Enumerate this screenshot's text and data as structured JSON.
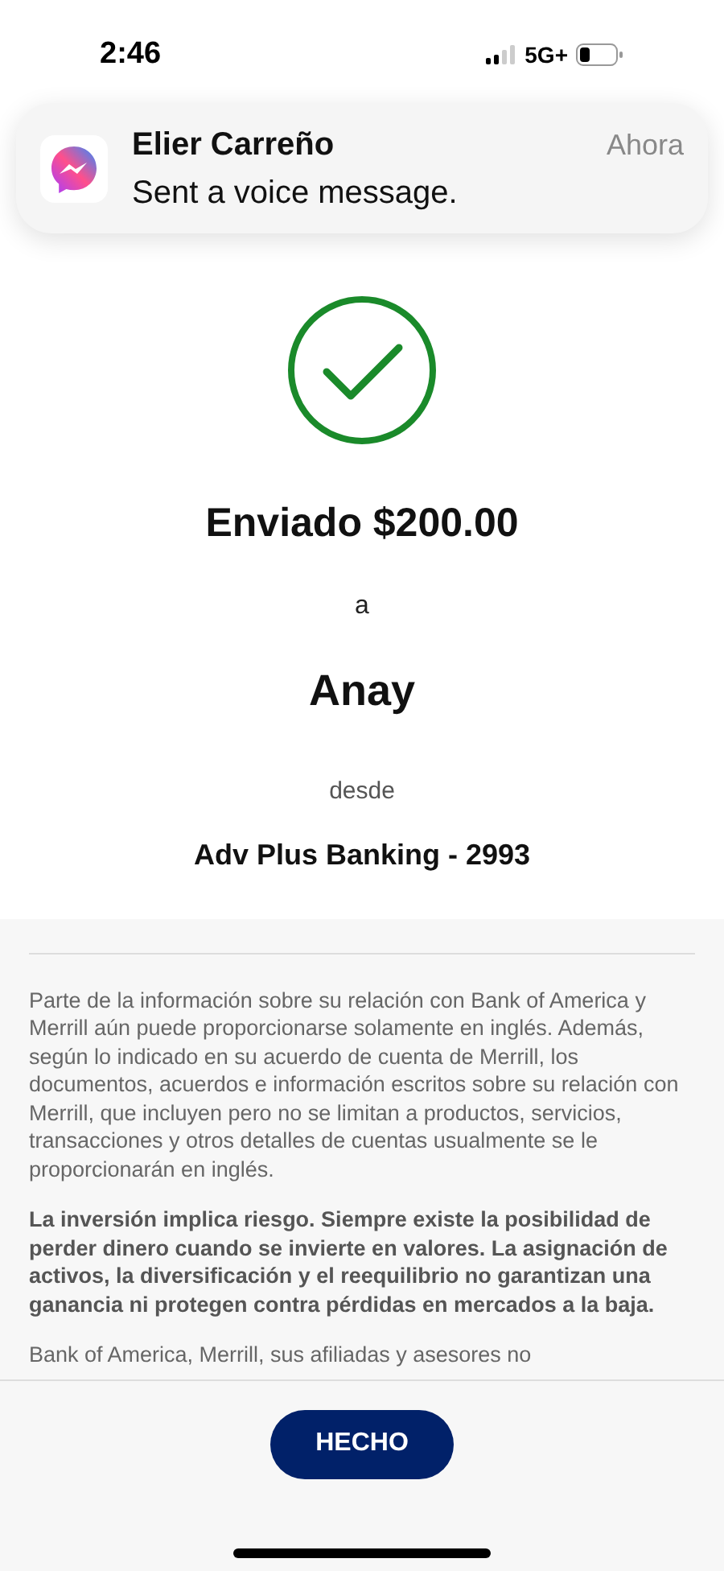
{
  "status_bar": {
    "time": "2:46",
    "network": "5G+"
  },
  "notification": {
    "sender": "Elier Carreño",
    "message": "Sent a voice message.",
    "time": "Ahora"
  },
  "confirmation": {
    "title": "Enviado $200.00",
    "to_label": "a",
    "recipient": "Anay",
    "from_label": "desde",
    "account": "Adv Plus Banking - 2993"
  },
  "disclosures": [
    {
      "text": "Parte de la información sobre su relación con Bank of America y Merrill aún puede proporcionarse solamente en inglés. Además, según lo indicado en su acuerdo de cuenta de Merrill, los documentos, acuerdos e información escritos sobre su relación con Merrill, que incluyen pero no se limitan a productos, servicios, transacciones y otros detalles de cuentas usualmente se le proporcionarán en inglés.",
      "bold": false
    },
    {
      "text": "La inversión implica riesgo. Siempre existe la posibilidad de perder dinero cuando se invierte en valores. La asignación de activos, la diversificación y el reequilibrio no garantizan una ganancia ni protegen contra pérdidas en mercados a la baja.",
      "bold": true
    },
    {
      "text": "Bank of America, Merrill, sus afiliadas y asesores no",
      "bold": false
    }
  ],
  "done_button": "HECHO"
}
